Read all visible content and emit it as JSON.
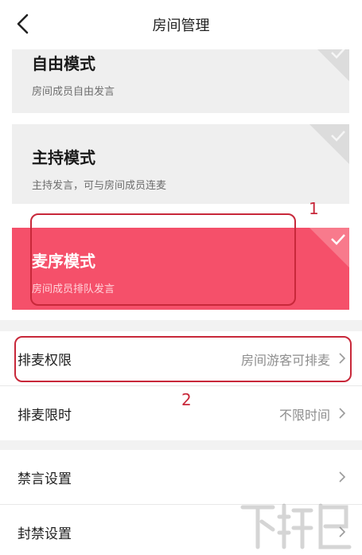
{
  "header": {
    "title": "房间管理"
  },
  "modes": [
    {
      "title": "自由模式",
      "desc": "房间成员自由发言",
      "selected": false
    },
    {
      "title": "主持模式",
      "desc": "主持发言，可与房间成员连麦",
      "selected": false
    },
    {
      "title": "麦序模式",
      "desc": "房间成员排队发言",
      "selected": true
    }
  ],
  "settings": [
    {
      "label": "排麦权限",
      "value": "房间游客可排麦"
    },
    {
      "label": "排麦限时",
      "value": "不限时间"
    },
    {
      "label": "禁言设置",
      "value": ""
    },
    {
      "label": "封禁设置",
      "value": ""
    }
  ],
  "annotations": {
    "one": "1",
    "two": "2"
  },
  "colors": {
    "accent": "#f5506a",
    "annotation": "#c8283a",
    "card": "#efefef"
  },
  "watermark": {
    "text": "下载吧"
  }
}
